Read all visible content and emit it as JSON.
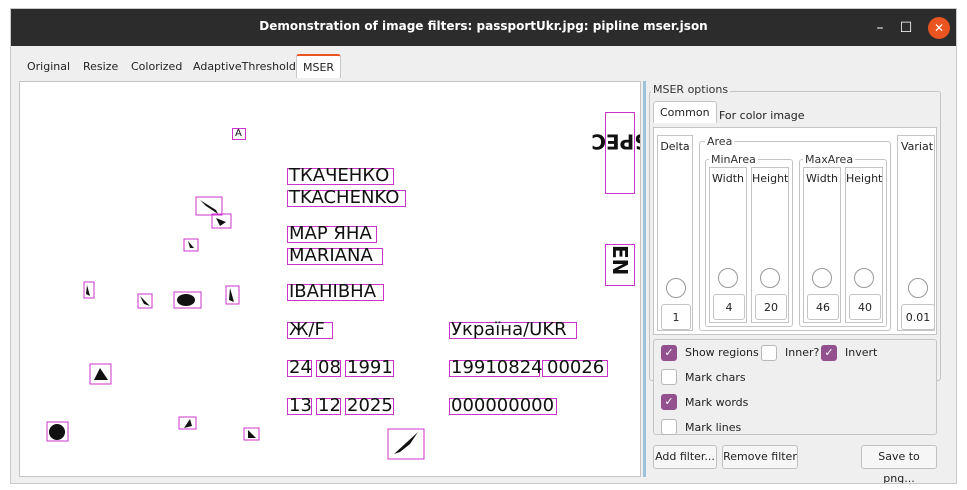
{
  "window": {
    "title": "Demonstration of image filters: passportUkr.jpg: pipline mser.json",
    "controls": {
      "minimize": "–",
      "maximize": "☐",
      "close": "✕"
    }
  },
  "tabs": [
    "Original",
    "Resize",
    "Colorized",
    "AdaptiveThreshold",
    "MSER"
  ],
  "active_tab": "MSER",
  "document": {
    "lines": {
      "surname_cyr": "ТКАЧЕНКО",
      "surname_lat": "TKACHENKO",
      "name_cyr": "МАР ЯНА",
      "name_lat": "MARIANA",
      "patronymic": "ІВАНІВНА",
      "sex": "Ж/F",
      "nationality": "Україна/UKR",
      "birth_day": "24",
      "birth_month": "08",
      "birth_year": "1991",
      "record_no": "19910824",
      "record_suffix": "00026",
      "expiry_day": "13",
      "expiry_month": "12",
      "expiry_year": "2025",
      "doc_number": "000000000",
      "specimen_spec": "SPEC",
      "specimen_en": "EN",
      "small_a": "А"
    }
  },
  "options": {
    "group_title": "MSER options",
    "subtabs": [
      "Common",
      "For color image"
    ],
    "active_subtab": "Common",
    "delta": {
      "label": "Delta",
      "value": "1"
    },
    "area": {
      "label": "Area",
      "min_area": {
        "label": "MinArea",
        "width_label": "Width",
        "height_label": "Height",
        "width": "4",
        "height": "20"
      },
      "max_area": {
        "label": "MaxArea",
        "width_label": "Width",
        "height_label": "Height",
        "width": "46",
        "height": "40"
      }
    },
    "variation": {
      "label": "Variatio",
      "value": "0.01"
    },
    "checkboxes": {
      "show_regions": {
        "label": "Show regions",
        "checked": true
      },
      "inner": {
        "label": "Inner?",
        "checked": false
      },
      "invert": {
        "label": "Invert",
        "checked": true
      },
      "mark_chars": {
        "label": "Mark chars",
        "checked": false
      },
      "mark_words": {
        "label": "Mark words",
        "checked": true
      },
      "mark_lines": {
        "label": "Mark lines",
        "checked": false
      }
    }
  },
  "buttons": {
    "add_filter": "Add filter...",
    "remove_filter": "Remove filter",
    "save_png": "Save to png..."
  },
  "colors": {
    "accent": "#e95420",
    "checkbox": "#92508f",
    "region_box": "#cc33cc",
    "titlebar": "#2c2c2c"
  }
}
